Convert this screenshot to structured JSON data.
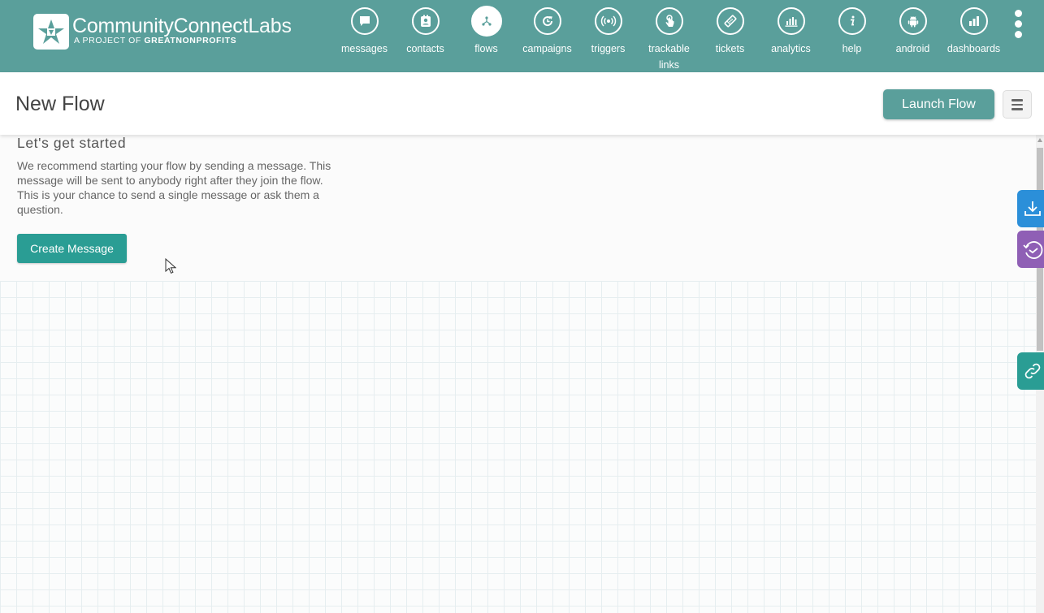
{
  "brand": {
    "name_main": "CommunityConnect",
    "name_suffix": "Labs",
    "tagline_prefix": "A PROJECT OF",
    "tagline_org": "GREATNONPROFITS"
  },
  "nav": {
    "items": [
      {
        "label": "messages",
        "icon": "chat-bubble-icon"
      },
      {
        "label": "contacts",
        "icon": "contact-card-icon"
      },
      {
        "label": "flows",
        "icon": "flow-tree-icon",
        "active": true
      },
      {
        "label": "campaigns",
        "icon": "clock-refresh-icon"
      },
      {
        "label": "triggers",
        "icon": "broadcast-icon"
      },
      {
        "label": "trackable",
        "label_line2": "links",
        "icon": "pointer-hand-icon"
      },
      {
        "label": "tickets",
        "icon": "ticket-icon"
      },
      {
        "label": "analytics",
        "icon": "bar-chart-icon"
      },
      {
        "label": "help",
        "icon": "info-icon"
      },
      {
        "label": "android",
        "icon": "android-icon"
      },
      {
        "label": "dashboards",
        "icon": "bar-graph-icon"
      }
    ]
  },
  "header": {
    "title": "New Flow",
    "launch_label": "Launch Flow"
  },
  "intro": {
    "title": "Let's get started",
    "text": "We recommend starting your flow by sending a message. This message will be sent to anybody right after they join the flow. This is your chance to send a single message or ask them a question.",
    "button_label": "Create Message"
  },
  "colors": {
    "nav_bg": "#5a9f9b",
    "primary_button": "#2a9d94",
    "download_tab": "#2b8fd9",
    "revisions_tab": "#8f5fb5",
    "link_tab": "#2a9d94"
  }
}
